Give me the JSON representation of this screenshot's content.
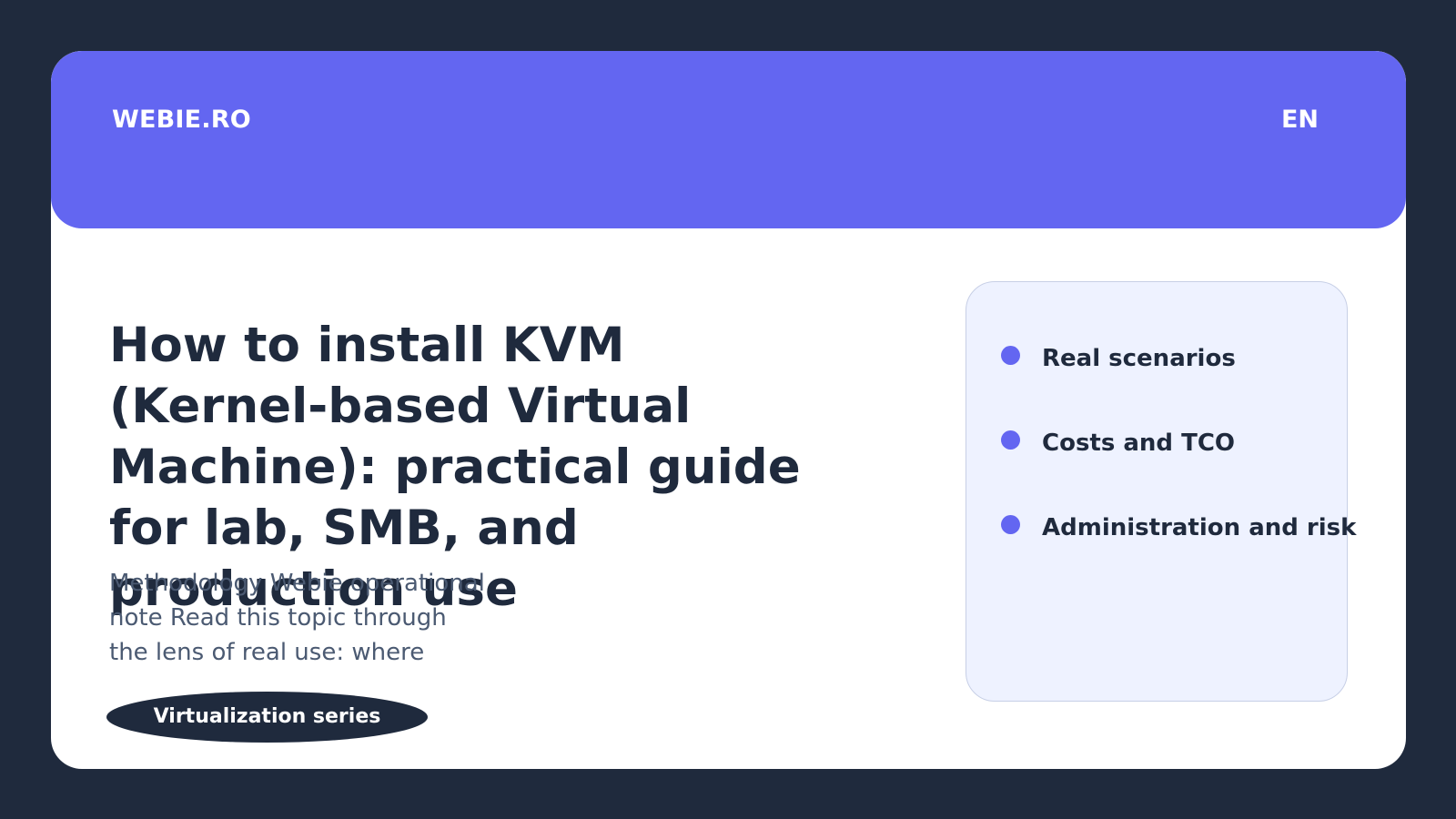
{
  "header": {
    "brand": "WEBIE.RO",
    "language": "EN"
  },
  "article": {
    "title": "How to install KVM (Kernel-based Virtual Machine): practical guide for lab, SMB, and production use",
    "excerpt": "Methodology Webie operational note Read this topic through the lens of real use: where",
    "series": "Virtualization series"
  },
  "topics": {
    "items": [
      {
        "label": "Real scenarios"
      },
      {
        "label": "Costs and TCO"
      },
      {
        "label": "Administration and risk"
      }
    ]
  },
  "colors": {
    "background": "#1f2a3d",
    "accent": "#6366f1",
    "card": "#ffffff",
    "panel": "#eef2ff",
    "text_dark": "#1f2a3d",
    "text_muted": "#4b5a72"
  }
}
